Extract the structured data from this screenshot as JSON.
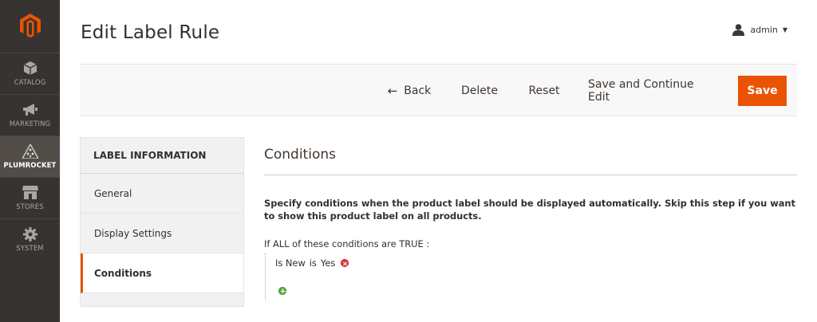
{
  "sidebar": {
    "logo": "magento-logo",
    "items": [
      {
        "label": "CATALOG",
        "icon": "box-icon"
      },
      {
        "label": "MARKETING",
        "icon": "megaphone-icon"
      },
      {
        "label": "PLUMROCKET",
        "icon": "plumrocket-icon"
      },
      {
        "label": "STORES",
        "icon": "store-icon"
      },
      {
        "label": "SYSTEM",
        "icon": "gear-icon"
      }
    ]
  },
  "header": {
    "title": "Edit Label Rule",
    "user": "admin"
  },
  "actions": {
    "back": "Back",
    "delete": "Delete",
    "reset": "Reset",
    "save_continue": "Save and Continue Edit",
    "save": "Save"
  },
  "tabs": {
    "heading": "LABEL INFORMATION",
    "items": [
      "General",
      "Display Settings",
      "Conditions"
    ],
    "active": "Conditions"
  },
  "main": {
    "section_title": "Conditions",
    "description": "Specify conditions when the product label should be displayed automatically. Skip this step if you want to show this product label on all products.",
    "cond_prefix": "If",
    "cond_aggregator": "ALL",
    "cond_middle": "of these conditions are",
    "cond_value": "TRUE",
    "cond_suffix": ":",
    "condition": {
      "attribute": "Is New",
      "operator": "is",
      "value": "Yes"
    }
  },
  "colors": {
    "accent": "#eb5202",
    "sidebar_bg": "#373330"
  }
}
